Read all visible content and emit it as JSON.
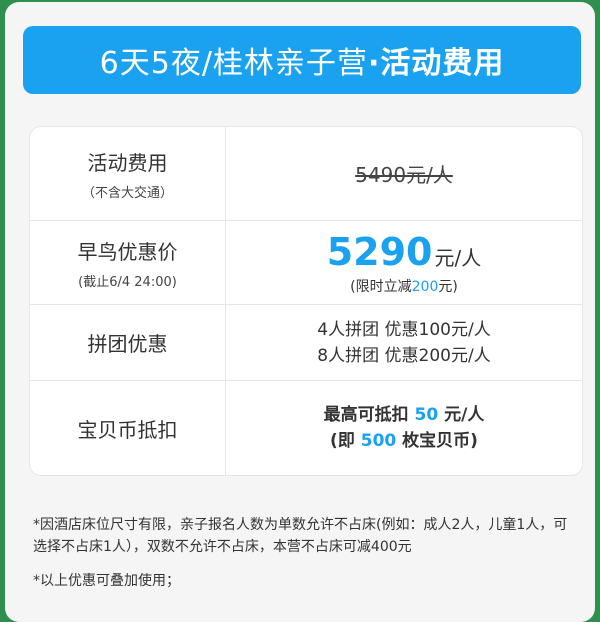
{
  "banner": {
    "title_plain": "6天5夜/桂林亲子营",
    "title_bold": "·活动费用"
  },
  "rows": [
    {
      "label": "活动费用",
      "sub": "（不含大交通）",
      "original_price": "5490元/人"
    },
    {
      "label": "早鸟优惠价",
      "sub": "(截止6/4  24:00)",
      "price": "5290",
      "unit": "元/人",
      "note_prefix": "(限时立减",
      "note_amount": "200",
      "note_suffix": "元)"
    },
    {
      "label": "拼团优惠",
      "line1": "4人拼团  优惠100元/人",
      "line2": "8人拼团  优惠200元/人"
    },
    {
      "label": "宝贝币抵扣",
      "line1_prefix": "最高可抵扣 ",
      "line1_amount": "50",
      "line1_suffix": " 元/人",
      "line2_prefix": "(即 ",
      "line2_amount": "500",
      "line2_suffix": " 枚宝贝币)"
    }
  ],
  "footer": {
    "note1": "*因酒店床位尺寸有限，亲子报名人数为单数允许不占床(例如：成人2人，儿童1人，可选择不占床1人），双数不允许不占床，本营不占床可减400元",
    "note2": "*以上优惠可叠加使用；"
  },
  "colors": {
    "accent": "#1aa1f0",
    "background": "#f5f5f5"
  }
}
